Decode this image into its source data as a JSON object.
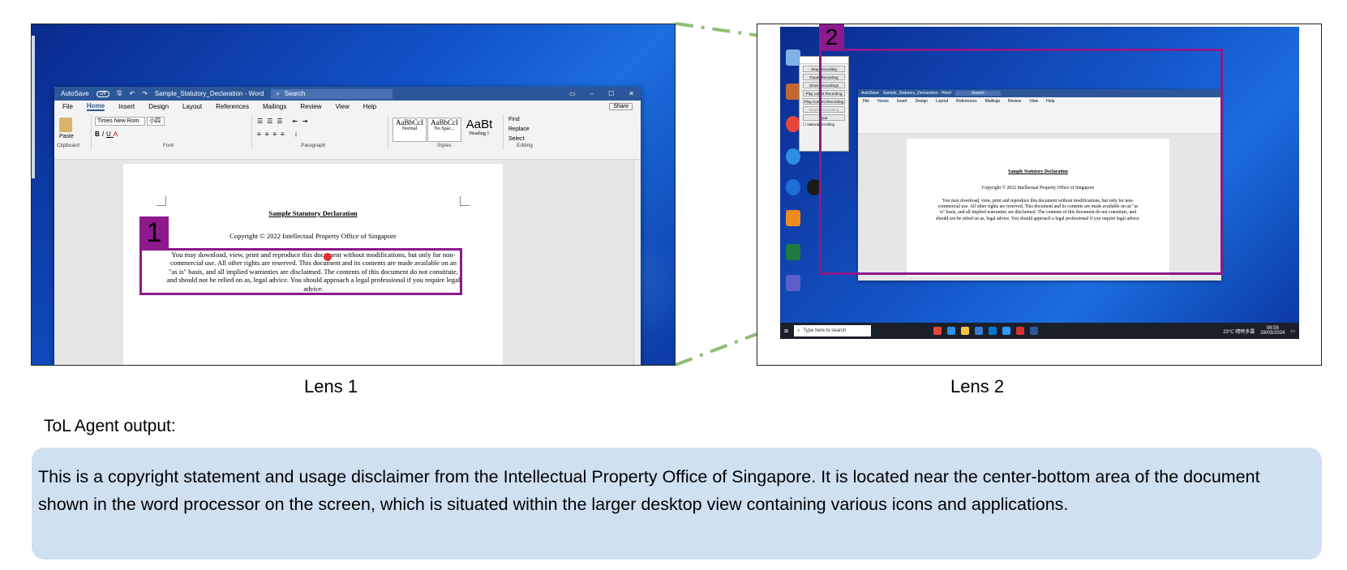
{
  "lens1": {
    "caption": "Lens 1",
    "badge": "1",
    "word": {
      "autosave": "AutoSave",
      "autosave_state": "Off",
      "doc_title": "Sample_Statutory_Declaration - Word",
      "search_placeholder": "Search",
      "menu": [
        "File",
        "Home",
        "Insert",
        "Design",
        "Layout",
        "References",
        "Mailings",
        "Review",
        "View",
        "Help"
      ],
      "share": "Share",
      "font_name": "Times New Rom",
      "font_size": "小四",
      "groups": [
        "Clipboard",
        "Font",
        "Paragraph",
        "Styles",
        "Editing"
      ],
      "paste": "Paste",
      "styles": [
        {
          "sample": "AaBbCcI",
          "name": "Normal"
        },
        {
          "sample": "AaBbCcI",
          "name": "No Spac..."
        },
        {
          "sample": "AaBt",
          "name": "Heading 1"
        }
      ],
      "editing": [
        "Find",
        "Replace",
        "Select"
      ]
    },
    "document": {
      "title": "Sample Statutory Declaration",
      "copyright": "Copyright © 2022 Intellectual Property Office of Singapore",
      "paragraph": "You may download, view, print and reproduce this document without modifications, but only for non-commercial use. All other rights are reserved. This document and its contents are made available on an \"as is\" basis, and all implied warranties are disclaimed. The contents of this document do not constitute, and should not be relied on as, legal advice. You should approach a legal professional if you require legal advice."
    }
  },
  "lens2": {
    "caption": "Lens 2",
    "badge": "2",
    "recorder": {
      "buttons": [
        "Stop Recording",
        "Pause Recording",
        "Show Recordings",
        "Play Latest Recording",
        "Play Custom Recording",
        "Replay Recording",
        "Quit"
      ],
      "checkbox": "Natural Scrolling"
    },
    "taskbar": {
      "search_placeholder": "Type here to search",
      "weather": "23°C 晴時多雲",
      "time": "08:58",
      "date": "28/03/2024"
    }
  },
  "agent": {
    "label": "ToL Agent output:",
    "output": "This is a copyright statement and usage disclaimer from the Intellectual Property Office of Singapore. It is located near the center-bottom area of the document shown in the word processor on the screen, which is situated within the larger desktop view containing various icons and applications."
  },
  "colors": {
    "highlight": "#8c1a8c",
    "connector": "#8fbf73",
    "output_bg": "#cfe0f1",
    "word_blue": "#2b579a"
  }
}
